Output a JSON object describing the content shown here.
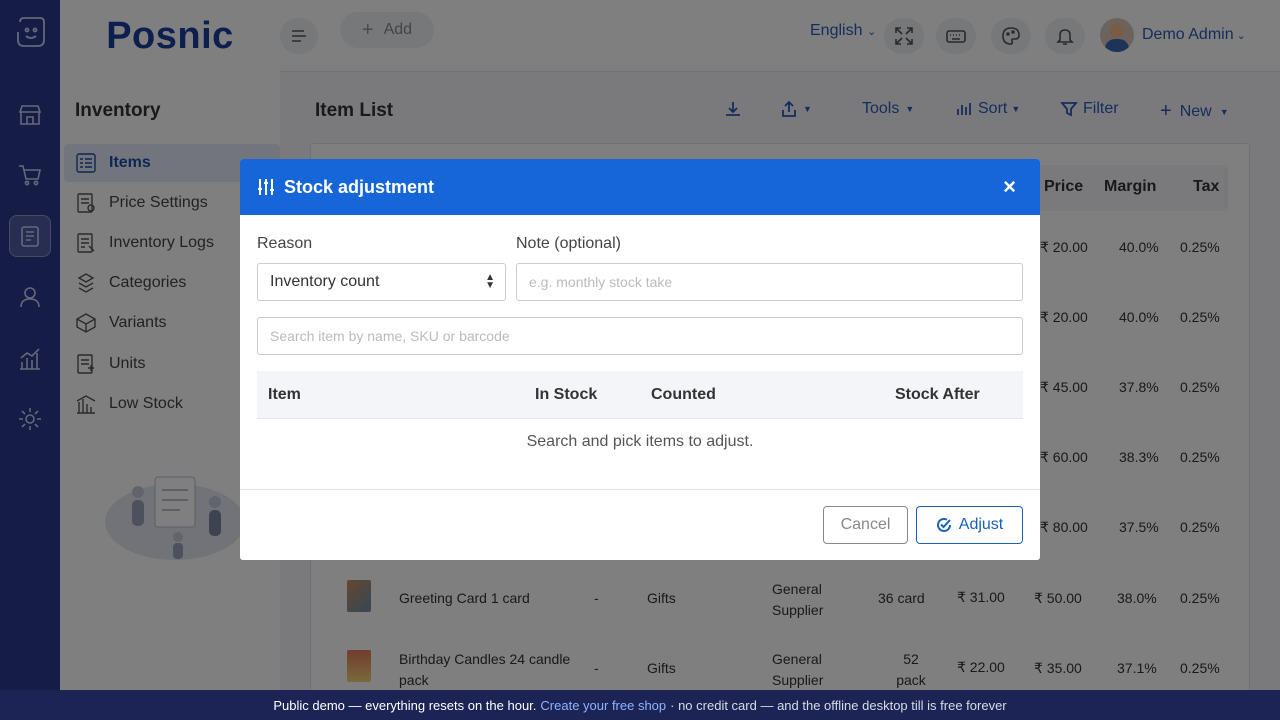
{
  "brand": {
    "name": "Posnic"
  },
  "sidebar": {
    "title": "Inventory",
    "items": [
      {
        "label": "Items",
        "icon": "items-icon"
      },
      {
        "label": "Price Settings",
        "icon": "price-icon"
      },
      {
        "label": "Inventory Logs",
        "icon": "logs-icon"
      },
      {
        "label": "Categories",
        "icon": "categories-icon"
      },
      {
        "label": "Variants",
        "icon": "variants-icon"
      },
      {
        "label": "Units",
        "icon": "units-icon"
      },
      {
        "label": "Low Stock",
        "icon": "low-stock-icon"
      }
    ]
  },
  "topbar": {
    "add_label": "Add",
    "language": "English",
    "user_name": "Demo Admin"
  },
  "content": {
    "title": "Item List",
    "actions": {
      "tools": "Tools",
      "sort": "Sort",
      "filter": "Filter",
      "new": "New"
    },
    "columns": {
      "price": "Price",
      "margin": "Margin",
      "tax": "Tax"
    },
    "partial_rows": [
      {
        "price": "₹ 20.00",
        "margin": "40.0%",
        "tax": "0.25%"
      },
      {
        "price": "₹ 20.00",
        "margin": "40.0%",
        "tax": "0.25%"
      },
      {
        "price": "₹ 45.00",
        "margin": "37.8%",
        "tax": "0.25%"
      },
      {
        "price": "₹ 60.00",
        "margin": "38.3%",
        "tax": "0.25%"
      },
      {
        "price": "₹ 80.00",
        "margin": "37.5%",
        "tax": "0.25%"
      }
    ],
    "full_rows": [
      {
        "name": "Greeting Card 1 card",
        "variant": "-",
        "category": "Gifts",
        "supplier": "General Supplier",
        "stock": "36 card",
        "cost": "₹ 31.00",
        "price": "₹ 50.00",
        "margin": "38.0%",
        "tax": "0.25%"
      },
      {
        "name": "Birthday Candles 24 candle pack",
        "variant": "-",
        "category": "Gifts",
        "supplier": "General Supplier",
        "stock": "52 pack",
        "cost": "₹ 22.00",
        "price": "₹ 35.00",
        "margin": "37.1%",
        "tax": "0.25%"
      }
    ]
  },
  "modal": {
    "title": "Stock adjustment",
    "close": "×",
    "reason_label": "Reason",
    "reason_value": "Inventory count",
    "note_label": "Note (optional)",
    "note_placeholder": "e.g. monthly stock take",
    "search_placeholder": "Search item by name, SKU or barcode",
    "columns": {
      "item": "Item",
      "in_stock": "In Stock",
      "counted": "Counted",
      "stock_after": "Stock After"
    },
    "empty_text": "Search and pick items to adjust.",
    "cancel": "Cancel",
    "adjust": "Adjust"
  },
  "footer_bar": {
    "text": "Public demo — everything resets on the hour.",
    "link": "Create your free shop",
    "tail": "· no credit card — and the offline desktop till is free forever"
  },
  "colors": {
    "rail": "#2b3a8e",
    "brand": "#1a3f9c",
    "modal_header": "#1666d9",
    "accent": "#1a5fb8",
    "bottom_bar": "#1b2454"
  }
}
